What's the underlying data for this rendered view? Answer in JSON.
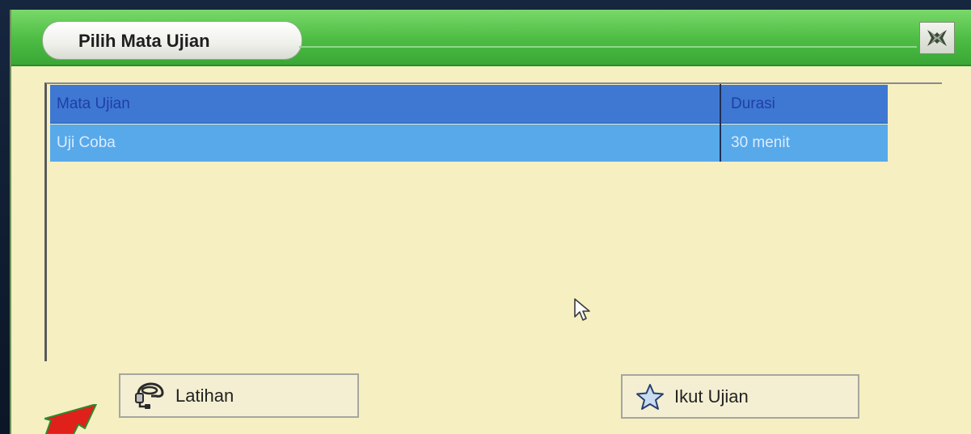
{
  "window": {
    "title": "Pilih Mata Ujian"
  },
  "table": {
    "columns": [
      "Mata Ujian",
      "Durasi"
    ],
    "rows": [
      {
        "subject": "Uji Coba",
        "duration": "30 menit"
      }
    ]
  },
  "buttons": {
    "latihan": "Latihan",
    "ikut_ujian": "Ikut Ujian"
  },
  "colors": {
    "titlebar_green": "#4cbc43",
    "panel_bg": "#f5efc2",
    "header_blue": "#3f78d2",
    "row_selected": "#58a9ea",
    "annotation_arrow": "#e0201a"
  },
  "icons": {
    "close": "close-x-icon",
    "latihan": "practice-headset-icon",
    "ikut_ujian": "star-icon",
    "pointer": "mouse-cursor-icon",
    "annotation": "red-arrow-annotation"
  }
}
